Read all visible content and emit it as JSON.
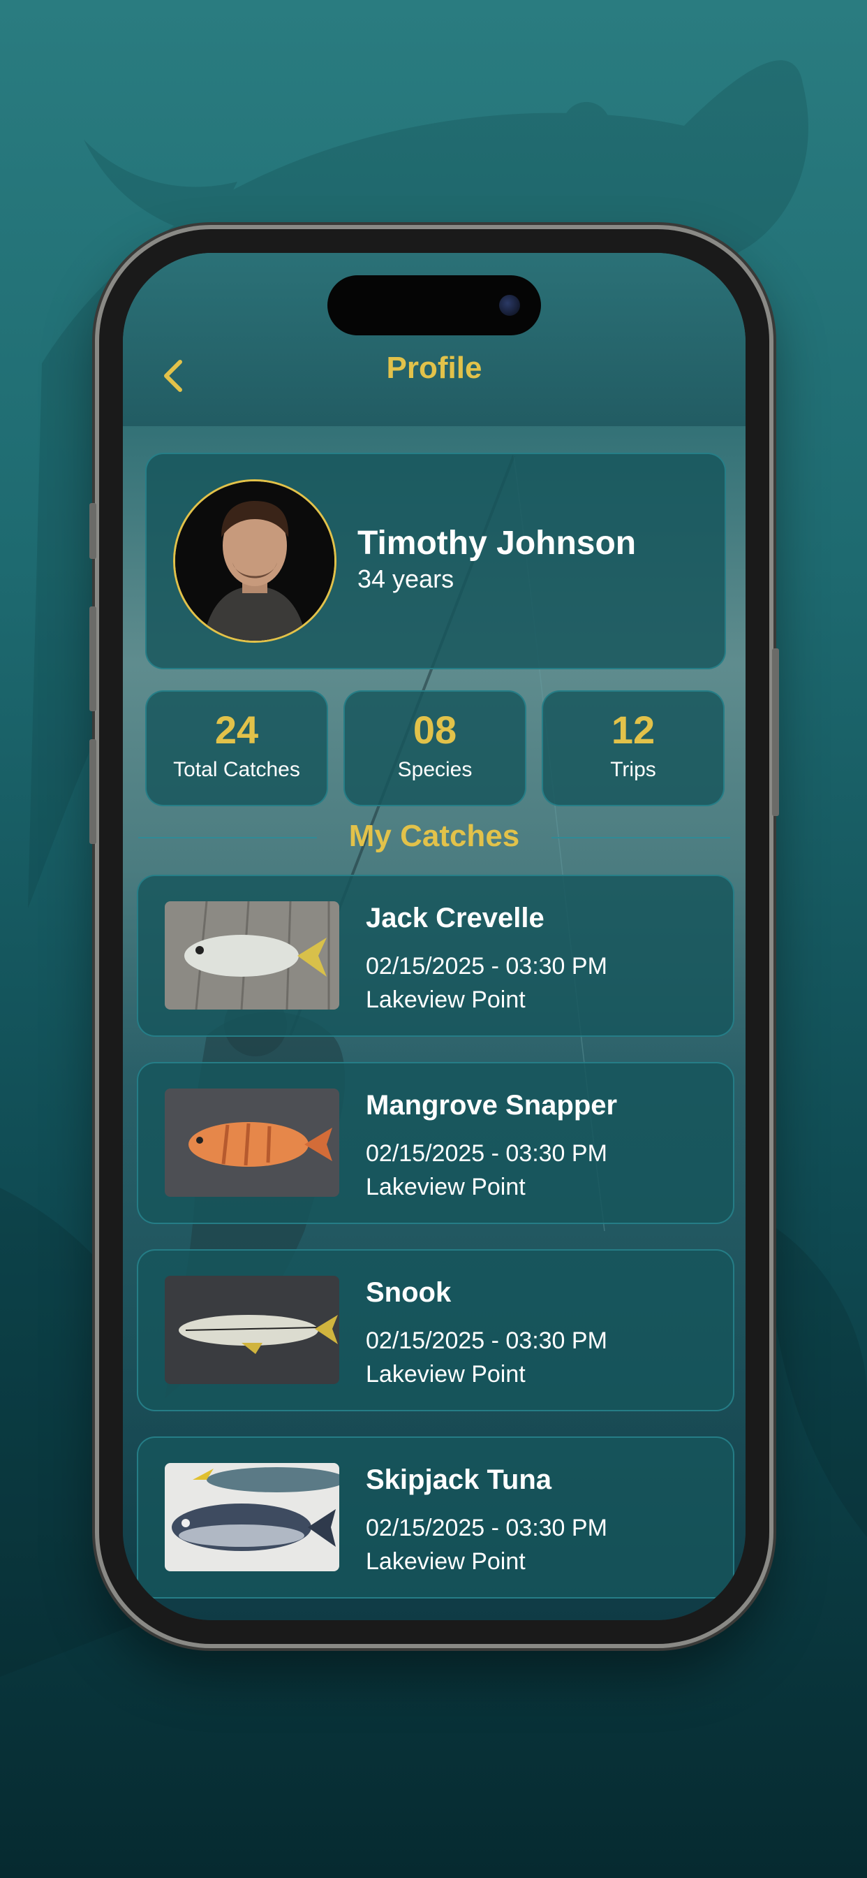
{
  "header": {
    "title": "Profile",
    "back_icon": "chevron-left-icon"
  },
  "profile": {
    "name": "Timothy Johnson",
    "age": "34 years"
  },
  "stats": [
    {
      "value": "24",
      "label": "Total Catches"
    },
    {
      "value": "08",
      "label": "Species"
    },
    {
      "value": "12",
      "label": "Trips"
    }
  ],
  "section": {
    "title": "My Catches"
  },
  "catches": [
    {
      "name": "Jack Crevelle",
      "datetime": "02/15/2025 - 03:30 PM",
      "location": "Lakeview Point"
    },
    {
      "name": "Mangrove Snapper",
      "datetime": "02/15/2025 - 03:30 PM",
      "location": "Lakeview Point"
    },
    {
      "name": "Snook",
      "datetime": "02/15/2025 - 03:30 PM",
      "location": "Lakeview Point"
    },
    {
      "name": "Skipjack Tuna",
      "datetime": "02/15/2025 - 03:30 PM",
      "location": "Lakeview Point"
    }
  ],
  "colors": {
    "accent": "#e2c24a",
    "card": "#16565c",
    "border": "#28828c",
    "background": "#1e6a70"
  }
}
